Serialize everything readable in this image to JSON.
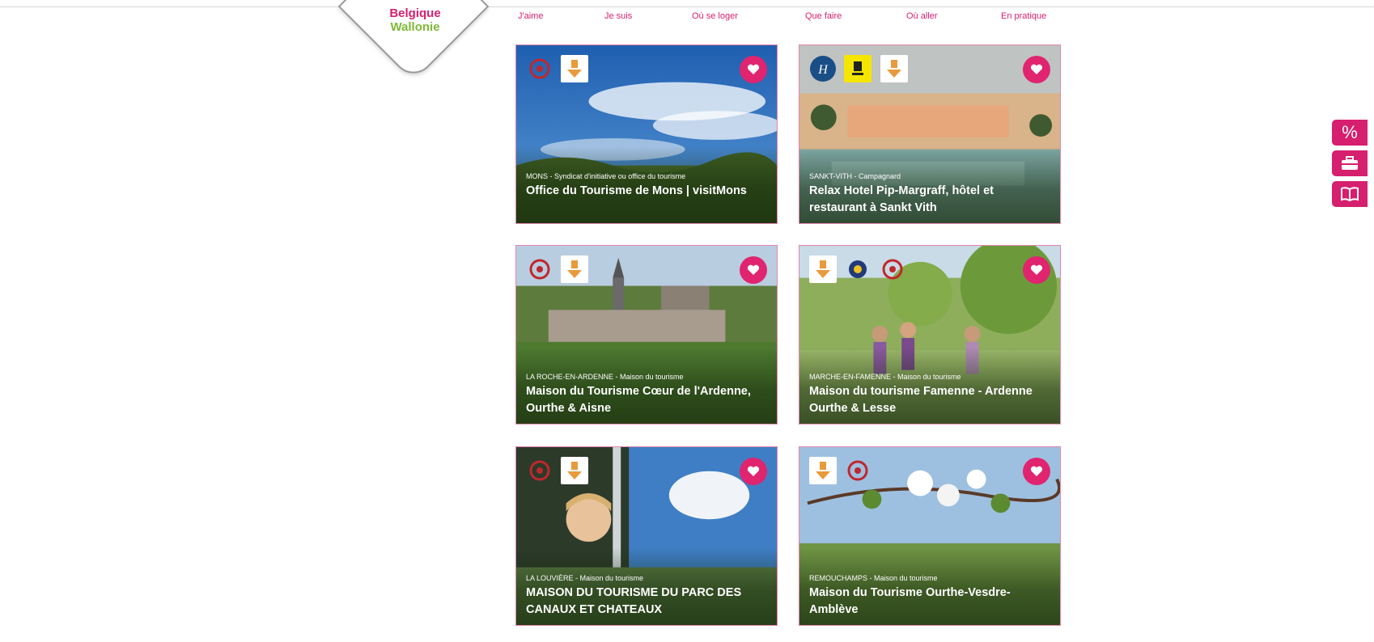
{
  "logo": {
    "line1": "Belgique",
    "line2": "Wallonie"
  },
  "nav": [
    "J'aime",
    "Je suis",
    "Où se loger",
    "Que faire",
    "Où aller",
    "En pratique"
  ],
  "cards": [
    {
      "subtitle": "MONS - Syndicat d'initiative ou office du tourisme",
      "title": "Office du Tourisme de Mons | visitMons"
    },
    {
      "subtitle": "SANKT-VITH - Campagnard",
      "title": "Relax Hotel Pip-Margraff, hôtel et restaurant à Sankt Vith"
    },
    {
      "subtitle": "LA ROCHE-EN-ARDENNE - Maison du tourisme",
      "title": "Maison du Tourisme Cœur de l'Ardenne, Ourthe & Aisne"
    },
    {
      "subtitle": "MARCHE-EN-FAMENNE - Maison du tourisme",
      "title": "Maison du tourisme Famenne - Ardenne Ourthe & Lesse"
    },
    {
      "subtitle": "LA LOUVIÈRE - Maison du tourisme",
      "title": "MAISON DU TOURISME DU PARC DES CANAUX ET CHATEAUX"
    },
    {
      "subtitle": "REMOUCHAMPS - Maison du tourisme",
      "title": "Maison du Tourisme Ourthe-Vesdre-Amblève"
    }
  ],
  "side_buttons": [
    {
      "label": "%",
      "icon": "percent-icon"
    },
    {
      "label": "",
      "icon": "suitcase-icon"
    },
    {
      "label": "",
      "icon": "book-icon"
    }
  ],
  "colors": {
    "accent": "#d61f6e",
    "green": "#7eb935"
  }
}
